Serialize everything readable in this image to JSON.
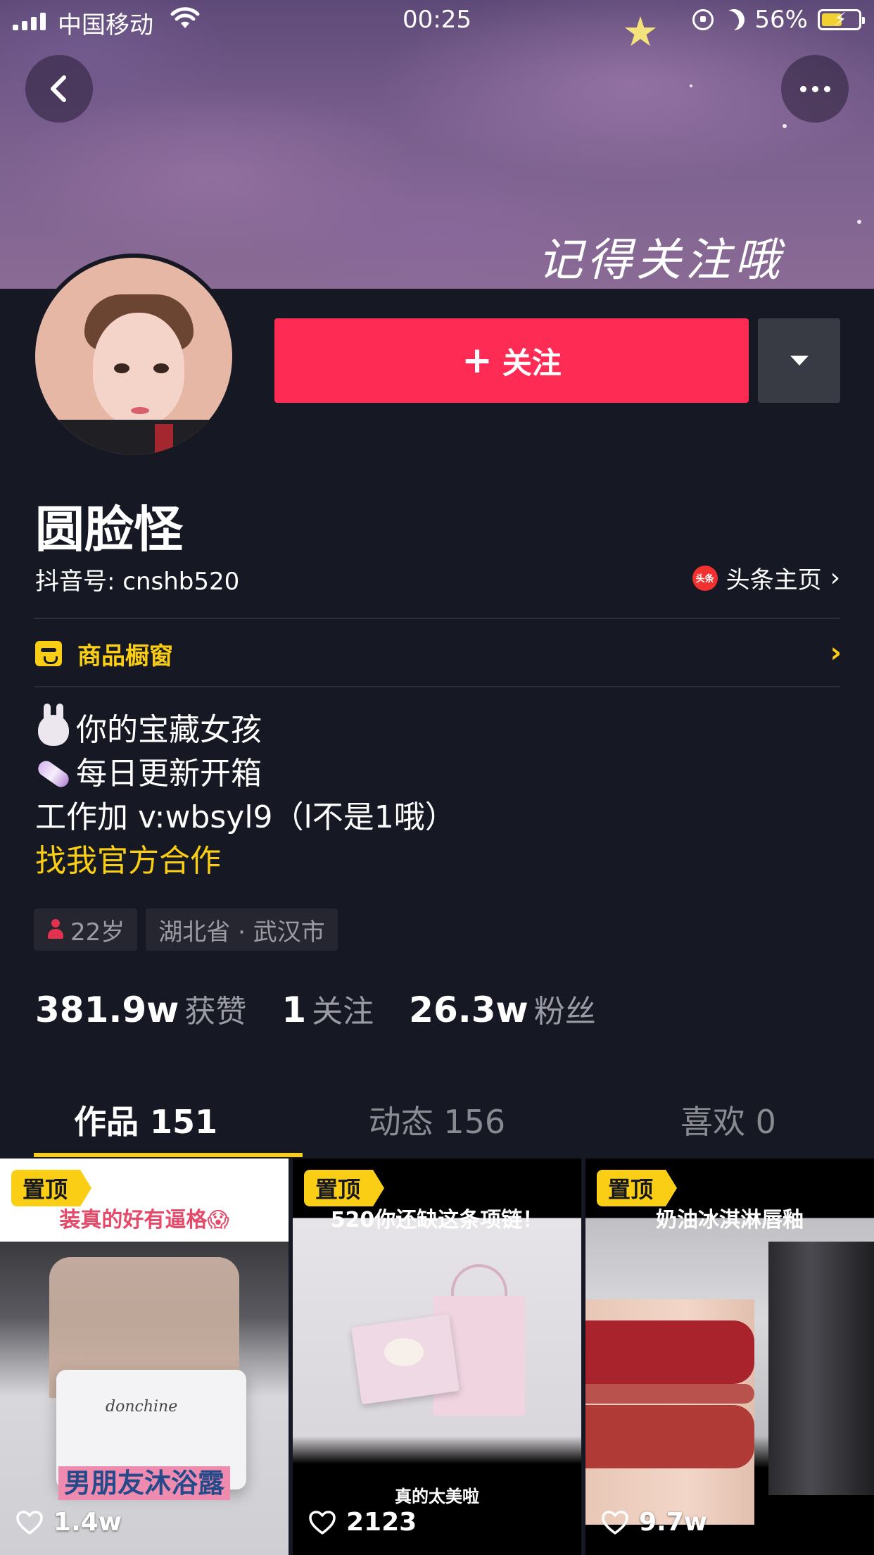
{
  "status_bar": {
    "carrier": "中国移动",
    "time": "00:25",
    "battery": "56%",
    "battery_level": 0.56
  },
  "banner": {
    "text": "记得关注哦"
  },
  "profile": {
    "nickname": "圆脸怪",
    "douyin_id": "抖音号: cnshb520",
    "toutiao_icon_text": "头条",
    "toutiao_label": "头条主页",
    "follow_label": "关注",
    "shop_label": "商品橱窗",
    "bio": {
      "line1": "你的宝藏女孩",
      "line2": "每日更新开箱",
      "line3": "工作加 v:wbsyl9（l不是1哦）",
      "line4": "找我官方合作"
    },
    "tags": {
      "age": "22岁",
      "location": "湖北省 · 武汉市"
    },
    "stats": [
      {
        "value": "381.9w",
        "label": "获赞"
      },
      {
        "value": "1",
        "label": "关注"
      },
      {
        "value": "26.3w",
        "label": "粉丝"
      }
    ]
  },
  "tabs": [
    {
      "label": "作品 151",
      "active": true
    },
    {
      "label": "动态 156",
      "active": false
    },
    {
      "label": "喜欢 0",
      "active": false
    }
  ],
  "videos": [
    {
      "pin": "置顶",
      "title": "装真的好有逼格😱",
      "caption": "男朋友沐浴露",
      "bag_brand": "donchine",
      "likes": "1.4w"
    },
    {
      "pin": "置顶",
      "title": "520你还缺这条项链！",
      "caption": "真的太美啦",
      "likes": "2123"
    },
    {
      "pin": "置顶",
      "title": "奶油冰淇淋唇釉",
      "likes": "9.7w"
    }
  ],
  "colors": {
    "background": "#161823",
    "follow": "#fe2c55",
    "accent_yellow": "#face15"
  },
  "icons": {
    "back": "chevron-left-icon",
    "more": "more-dots-icon",
    "dropdown": "triangle-down-icon",
    "shop": "shop-bag-icon",
    "like": "heart-outline-icon"
  }
}
